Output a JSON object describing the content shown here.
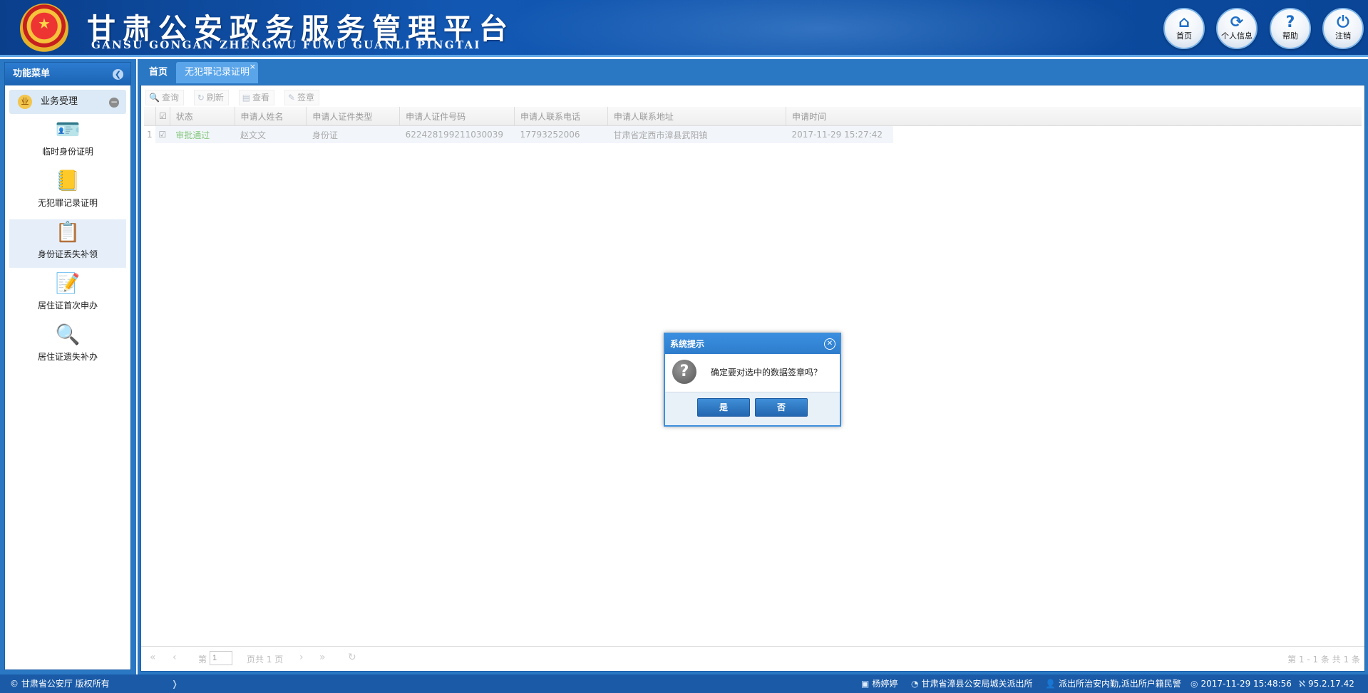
{
  "header": {
    "title_cn": "甘肃公安政务服务管理平台",
    "title_en": "GANSU GONGAN ZHENGWU FUWU GUANLI PINGTAI",
    "buttons": [
      {
        "label": "首页",
        "icon": "home-icon"
      },
      {
        "label": "个人信息",
        "icon": "refresh-user-icon"
      },
      {
        "label": "帮助",
        "icon": "help-icon"
      },
      {
        "label": "注销",
        "icon": "power-icon"
      }
    ]
  },
  "sidebar": {
    "title": "功能菜单",
    "group": "业务受理",
    "items": [
      {
        "label": "临时身份证明",
        "icon": "id-card-icon"
      },
      {
        "label": "无犯罪记录证明",
        "icon": "record-book-icon"
      },
      {
        "label": "身份证丢失补领",
        "icon": "clipboard-icon"
      },
      {
        "label": "居住证首次申办",
        "icon": "edit-pencil-icon"
      },
      {
        "label": "居住证遗失补办",
        "icon": "search-document-icon"
      }
    ]
  },
  "tabs": {
    "home": "首页",
    "active": "无犯罪记录证明",
    "close": "×"
  },
  "toolbar": {
    "query": "查询",
    "refresh": "刷新",
    "view": "查看",
    "sign": "签章"
  },
  "grid": {
    "columns": [
      "状态",
      "申请人姓名",
      "申请人证件类型",
      "申请人证件号码",
      "申请人联系电话",
      "申请人联系地址",
      "申请时间"
    ],
    "rows": [
      {
        "index": "1",
        "status": "审批通过",
        "name": "赵文文",
        "id_type": "身份证",
        "id_number": "622428199211030039",
        "phone": "17793252006",
        "address": "甘肃省定西市漳县武阳镇",
        "time": "2017-11-29 15:27:42"
      }
    ]
  },
  "pager": {
    "page_label_pre": "第",
    "page_value": "1",
    "page_label_post": "页共 1 页",
    "info": "第 1 - 1 条 共 1 条"
  },
  "footer": {
    "copyright": "© 甘肃省公安厅 版权所有",
    "user": "杨婷婷",
    "org": "甘肃省漳县公安局城关派出所",
    "role": "派出所治安内勤,派出所户籍民警",
    "datetime": "2017-11-29 15:48:56",
    "ip": "95.2.17.42"
  },
  "dialog": {
    "title": "系统提示",
    "message": "确定要对选中的数据签章吗？",
    "yes": "是",
    "no": "否"
  },
  "colors": {
    "header_blue": "#0d4fa6",
    "panel_blue": "#2a78c4",
    "status_green": "#86c77c",
    "dialog_blue": "#3a8ee0"
  }
}
